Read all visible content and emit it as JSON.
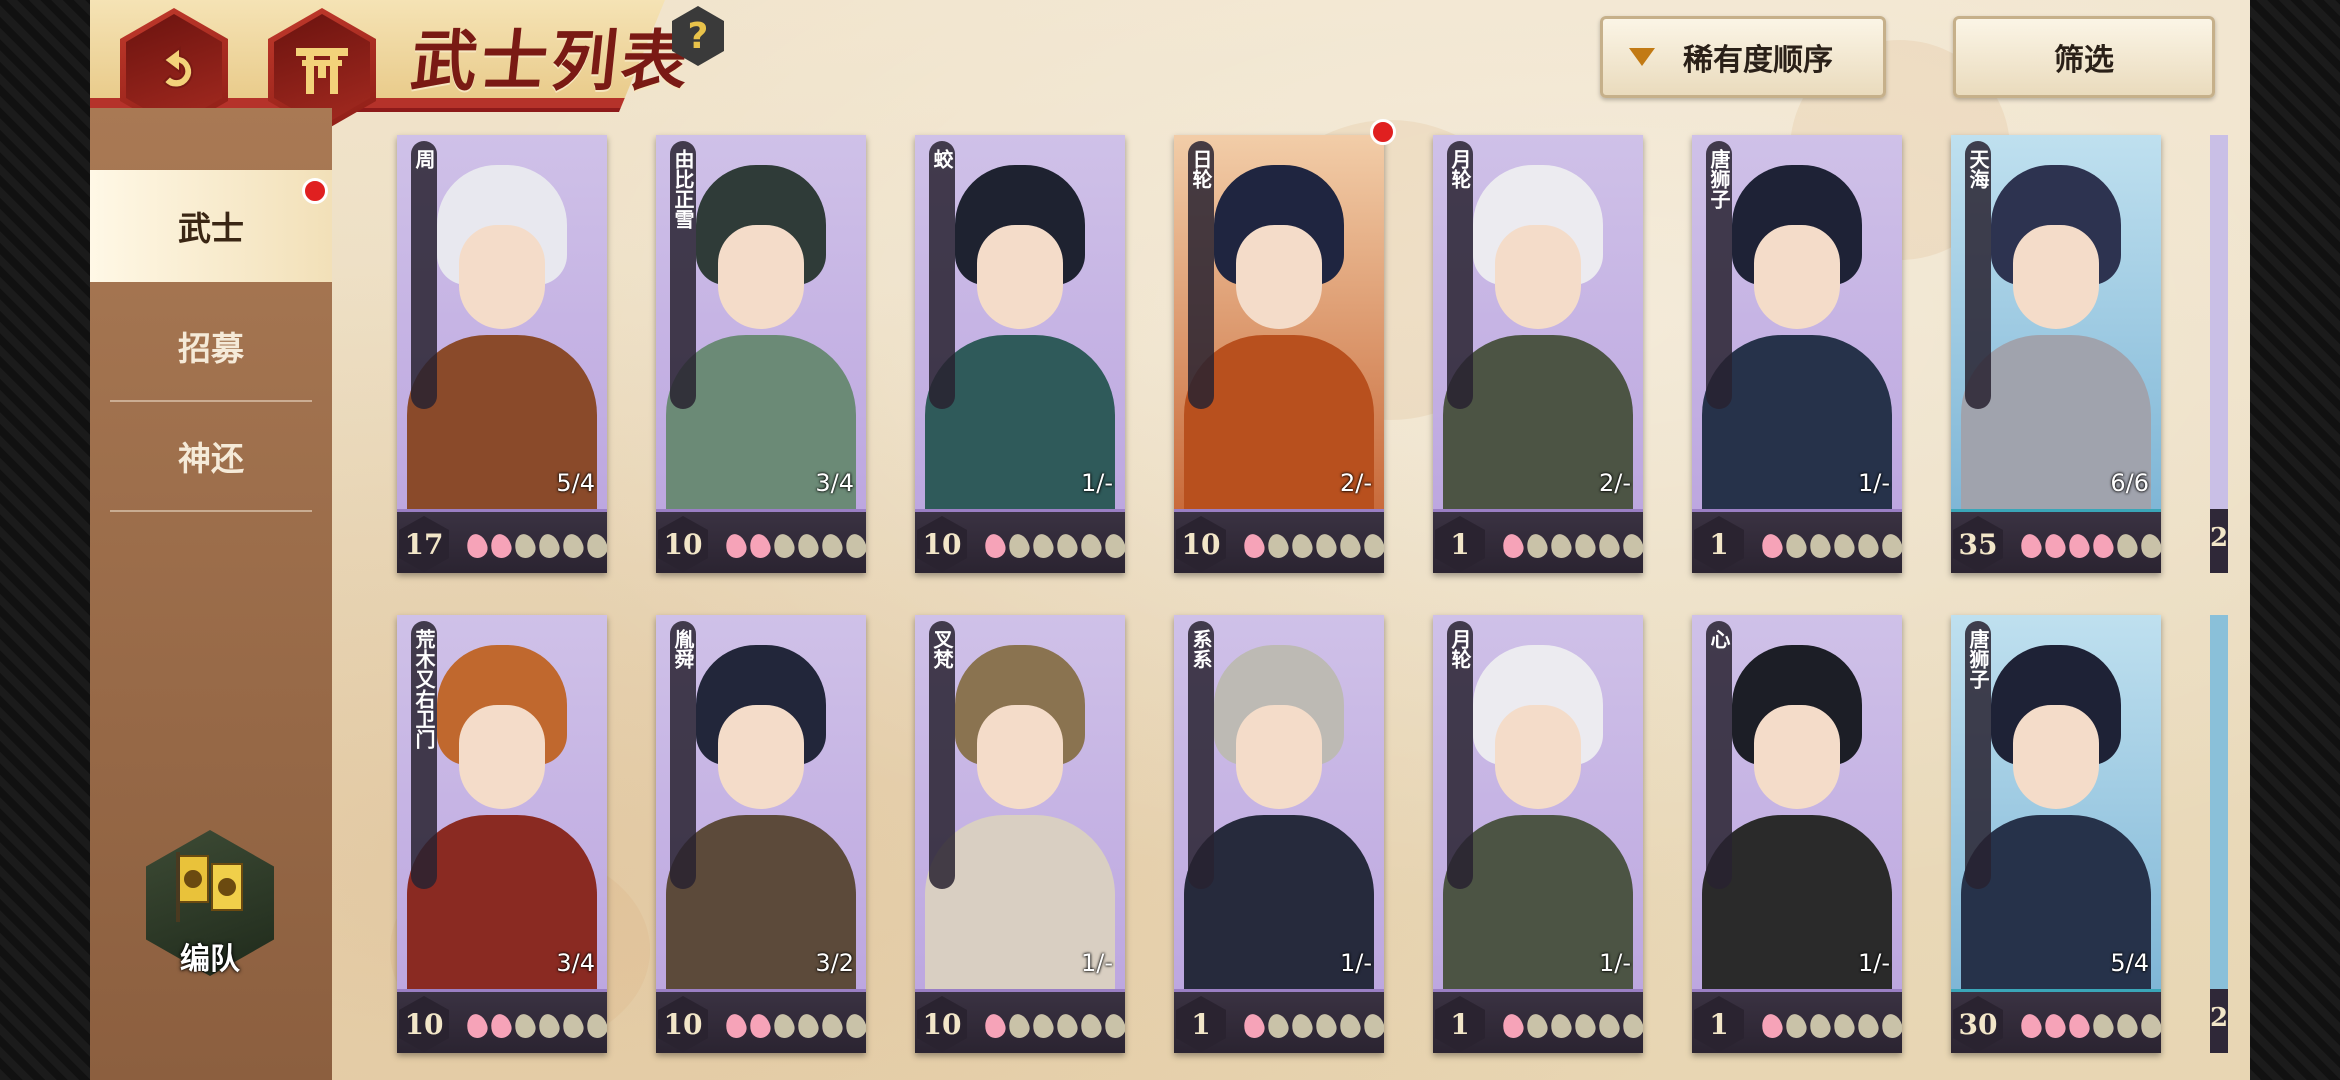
{
  "header": {
    "title": "武士列表",
    "help_label": "?",
    "sort_label": "稀有度顺序",
    "filter_label": "筛选"
  },
  "sidebar": {
    "tabs": [
      {
        "label": "武士",
        "active": true,
        "notification": true
      },
      {
        "label": "招募",
        "active": false
      },
      {
        "label": "神还",
        "active": false
      }
    ],
    "team_label": "编队"
  },
  "icons": {
    "back": "back-arrow-icon",
    "home": "shrine-gate-icon",
    "help": "question-icon",
    "sort": "caret-down-icon",
    "team": "banner-flag-icon"
  },
  "colors": {
    "accent_red": "#b5322a",
    "petal_on": "#f6a3b8",
    "petal_off": "#c9c2a8",
    "notify": "#e02020"
  },
  "cards": [
    {
      "name": "周",
      "level": "17",
      "limit": "5/4",
      "petals_on": 2,
      "bg": "purple",
      "hair": "#e8e8ef",
      "body": "#8a4a2a",
      "notification": false
    },
    {
      "name": "由比正雪",
      "level": "10",
      "limit": "3/4",
      "petals_on": 2,
      "bg": "purple",
      "hair": "#2f3b38",
      "body": "#6b8a76",
      "notification": false
    },
    {
      "name": "蛟",
      "level": "10",
      "limit": "1/-",
      "petals_on": 1,
      "bg": "purple",
      "hair": "#1e2230",
      "body": "#2f5a5a",
      "notification": false
    },
    {
      "name": "日轮",
      "level": "10",
      "limit": "2/-",
      "petals_on": 1,
      "bg": "orange",
      "hair": "#1f2540",
      "body": "#b8501e",
      "notification": true
    },
    {
      "name": "月轮",
      "level": "1",
      "limit": "2/-",
      "petals_on": 1,
      "bg": "purple",
      "hair": "#ecebf0",
      "body": "#4c5444",
      "notification": false
    },
    {
      "name": "唐狮子",
      "level": "1",
      "limit": "1/-",
      "petals_on": 1,
      "bg": "purple",
      "hair": "#1e2236",
      "body": "#26324a",
      "notification": false
    },
    {
      "name": "天海",
      "level": "35",
      "limit": "6/6",
      "petals_on": 4,
      "bg": "blue",
      "hair": "#2d3350",
      "body": "#a0a3ad",
      "notification": false
    },
    {
      "name": "荒木又右卫门",
      "level": "10",
      "limit": "3/4",
      "petals_on": 2,
      "bg": "purple",
      "hair": "#c0682e",
      "body": "#8a2a22",
      "notification": false
    },
    {
      "name": "胤舜",
      "level": "10",
      "limit": "3/2",
      "petals_on": 2,
      "bg": "purple",
      "hair": "#22263a",
      "body": "#5c4a3a",
      "notification": false
    },
    {
      "name": "叉梵",
      "level": "10",
      "limit": "1/-",
      "petals_on": 1,
      "bg": "purple",
      "hair": "#8a7350",
      "body": "#d9cfc2",
      "notification": false
    },
    {
      "name": "系系",
      "level": "1",
      "limit": "1/-",
      "petals_on": 1,
      "bg": "purple",
      "hair": "#bdbab4",
      "body": "#262a3c",
      "notification": false
    },
    {
      "name": "月轮",
      "level": "1",
      "limit": "1/-",
      "petals_on": 1,
      "bg": "purple",
      "hair": "#ecebf0",
      "body": "#4c5444",
      "notification": false
    },
    {
      "name": "心",
      "level": "1",
      "limit": "1/-",
      "petals_on": 1,
      "bg": "purple",
      "hair": "#1c1e26",
      "body": "#2a2a2a",
      "notification": false
    },
    {
      "name": "唐狮子",
      "level": "30",
      "limit": "5/4",
      "petals_on": 3,
      "bg": "blue",
      "hair": "#1e2236",
      "body": "#26324a",
      "notification": false
    }
  ],
  "peek_cards": [
    {
      "level": "2",
      "bg": "purple"
    },
    {
      "level": "2",
      "bg": "blue"
    }
  ]
}
